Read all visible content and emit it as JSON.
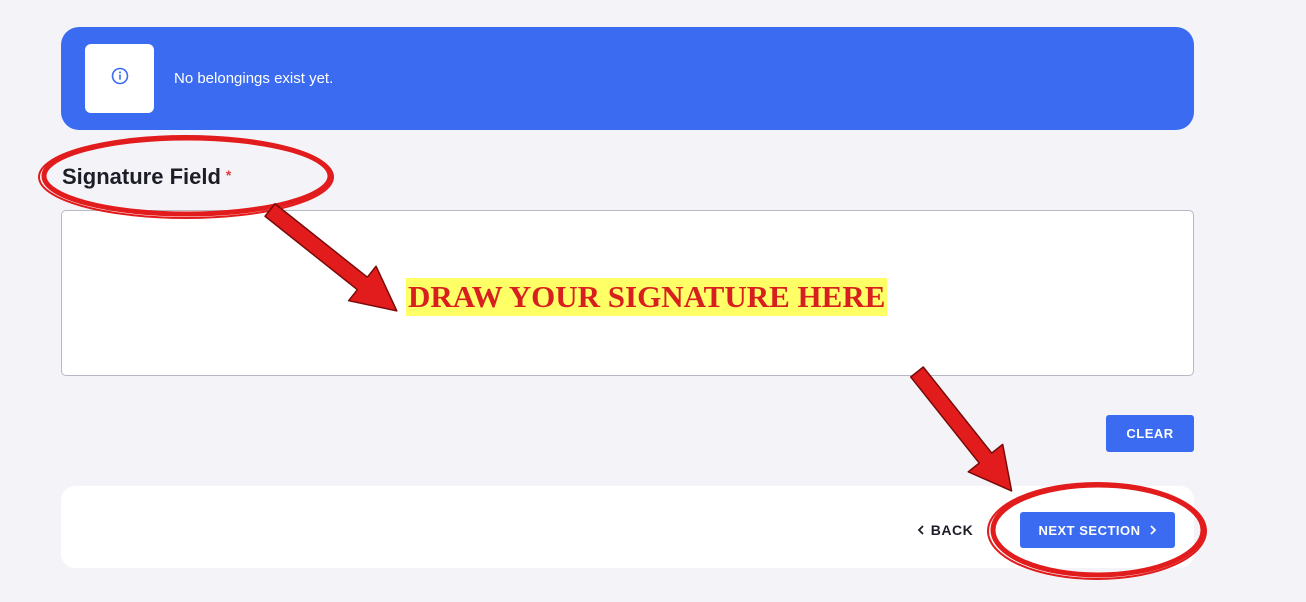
{
  "alert": {
    "message": "No belongings exist yet.",
    "icon": "info-icon",
    "color": "#3a6bf0"
  },
  "signature": {
    "label": "Signature Field",
    "required_mark": "*"
  },
  "annotation": {
    "hint": "DRAW YOUR SIGNATURE HERE",
    "hint_color": "#d81f1f",
    "highlight_color": "#ffff66",
    "arrow_color": "#e21c1c"
  },
  "buttons": {
    "clear": "CLEAR",
    "back": "BACK",
    "next": "NEXT SECTION"
  },
  "colors": {
    "accent": "#3a6bf0",
    "background": "#f4f4f8"
  }
}
